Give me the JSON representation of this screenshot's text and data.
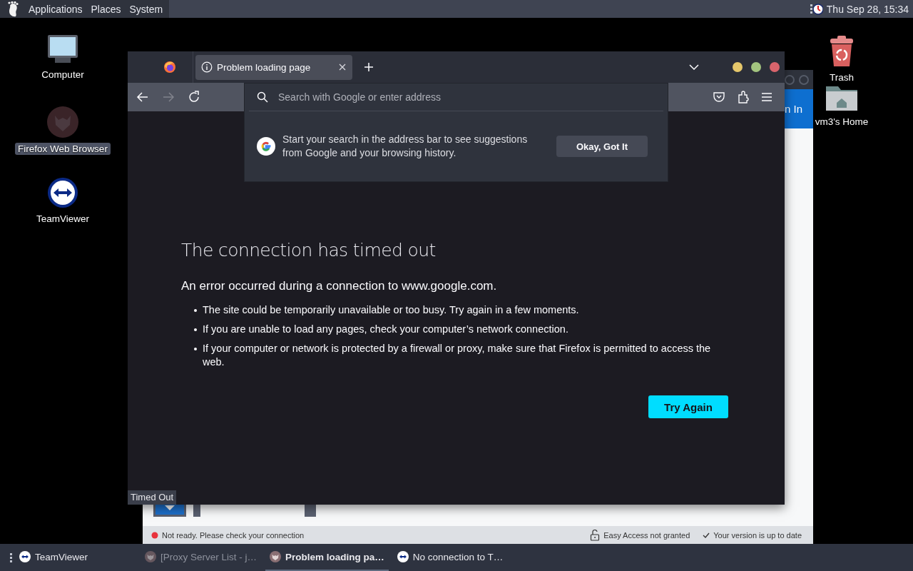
{
  "top_panel": {
    "menus": [
      "Applications",
      "Places",
      "System"
    ],
    "clock": "Thu Sep 28, 15:34"
  },
  "desktop_icons_left": [
    {
      "label": "Computer",
      "kind": "computer",
      "selected": false
    },
    {
      "label": "Firefox Web Browser",
      "kind": "firefox",
      "selected": true
    },
    {
      "label": "TeamViewer",
      "kind": "teamviewer",
      "selected": false
    }
  ],
  "desktop_icons_right": [
    {
      "label": "Trash",
      "kind": "trash",
      "selected": false
    },
    {
      "label": "vm3's Home",
      "kind": "home",
      "selected": false
    }
  ],
  "background_window": {
    "header_text": "n In",
    "status_items": [
      {
        "kind": "error",
        "text": "Not ready. Please check your connection"
      },
      {
        "kind": "lock",
        "text": "Easy Access not granted"
      },
      {
        "kind": "check",
        "text": "Your version is up to date"
      }
    ]
  },
  "browser": {
    "tabs": [
      {
        "title": "Problem loading page",
        "selected": true
      }
    ],
    "forward_disabled": true,
    "address_bar": {
      "placeholder": "Search with Google or enter address"
    },
    "suggestion": {
      "text": "Start your search in the address bar to see suggestions from Google and your browsing history.",
      "button": "Okay, Got It"
    },
    "error_page": {
      "title": "The connection has timed out",
      "subtitle": "An error occurred during a connection to www.google.com.",
      "bullets": [
        "The site could be temporarily unavailable or too busy. Try again in a few moments.",
        "If you are unable to load any pages, check your computer’s network connection.",
        "If your computer or network is protected by a firewall or proxy, make sure that Firefox is permitted to access the web."
      ],
      "button": "Try Again"
    },
    "status_text": "Timed Out"
  },
  "taskbar": [
    {
      "label": "TeamViewer",
      "kind": "teamviewer",
      "minimized": false,
      "selected": false
    },
    {
      "label": "[Proxy Server List - j…",
      "kind": "firefox",
      "minimized": true,
      "selected": false
    },
    {
      "label": "Problem loading pa…",
      "kind": "firefox",
      "minimized": false,
      "selected": true
    },
    {
      "label": "No connection to T…",
      "kind": "teamviewer",
      "minimized": false,
      "selected": false
    }
  ]
}
